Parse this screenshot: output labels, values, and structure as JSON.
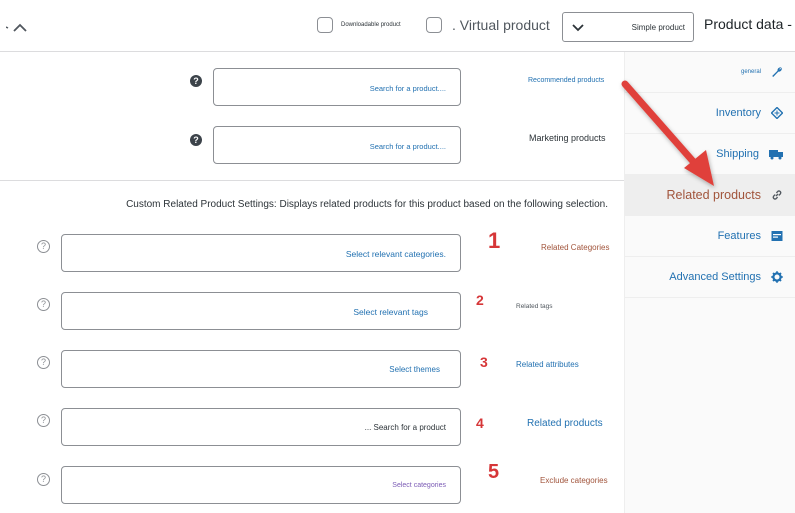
{
  "header": {
    "title": "Product data -",
    "product_type": "Simple product",
    "virtual_label": ". Virtual product",
    "downloadable_label": "Downloadable product"
  },
  "tabs": [
    {
      "label": "general",
      "icon": "wrench-icon"
    },
    {
      "label": "Inventory",
      "icon": "tag-icon"
    },
    {
      "label": "Shipping",
      "icon": "truck-icon"
    },
    {
      "label": "Related products",
      "icon": "link-icon"
    },
    {
      "label": "Features",
      "icon": "window-icon"
    },
    {
      "label": "Advanced Settings",
      "icon": "gear-icon"
    }
  ],
  "recommended": {
    "label": "Recommended products",
    "placeholder": "Search for a product...."
  },
  "marketing": {
    "label": "Marketing products",
    "placeholder": "Search for a product...."
  },
  "description": "Custom Related Product Settings: Displays related products for this product based on the following selection.",
  "fields": [
    {
      "number": "1",
      "label": "Related Categories",
      "placeholder": "Select relevant categories."
    },
    {
      "number": "2",
      "label": "Related tags",
      "placeholder": "Select relevant tags"
    },
    {
      "number": "3",
      "label": "Related attributes",
      "placeholder": "Select themes"
    },
    {
      "number": "4",
      "label": "Related products",
      "placeholder": "... Search for a product"
    },
    {
      "number": "5",
      "label": "Exclude categories",
      "placeholder": "Select categories"
    }
  ],
  "colors": {
    "accent": "#2271b1",
    "active_tab": "#a1543b",
    "annotation": "#d63638"
  }
}
